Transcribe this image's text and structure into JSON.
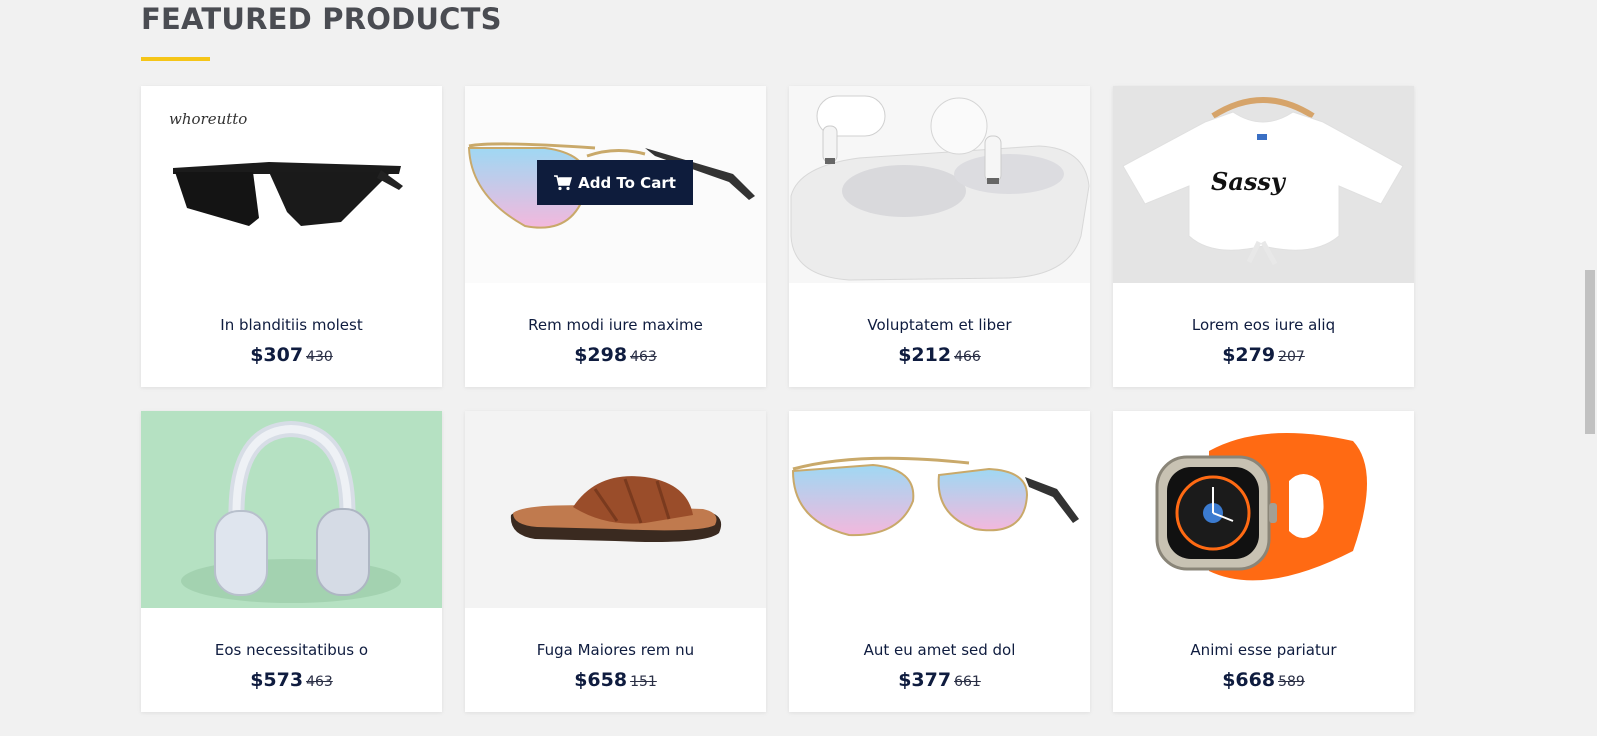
{
  "section": {
    "title": "FEATURED PRODUCTS",
    "accent_color": "#f5c518"
  },
  "add_to_cart_label": "Add To Cart",
  "products": [
    {
      "name": "In blanditiis molest",
      "price": "$307",
      "old_price": "430",
      "image": "black-sunglasses-icon"
    },
    {
      "name": "Rem modi iure maxime",
      "price": "$298",
      "old_price": "463",
      "image": "aviator-sunglasses-icon"
    },
    {
      "name": "Voluptatem et liber",
      "price": "$212",
      "old_price": "466",
      "image": "earbuds-case-icon"
    },
    {
      "name": "Lorem eos iure aliq",
      "price": "$279",
      "old_price": "207",
      "image": "tshirt-icon"
    },
    {
      "name": "Eos necessitatibus o",
      "price": "$573",
      "old_price": "463",
      "image": "headphones-icon"
    },
    {
      "name": "Fuga Maiores rem nu",
      "price": "$658",
      "old_price": "151",
      "image": "sandal-icon"
    },
    {
      "name": "Aut eu amet sed dol",
      "price": "$377",
      "old_price": "661",
      "image": "aviator-sunglasses-icon"
    },
    {
      "name": "Animi esse pariatur",
      "price": "$668",
      "old_price": "589",
      "image": "smartwatch-icon"
    }
  ]
}
